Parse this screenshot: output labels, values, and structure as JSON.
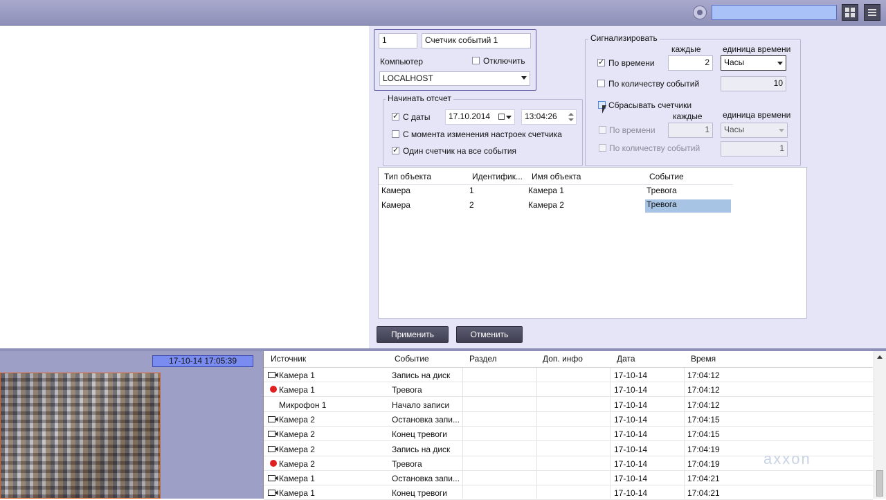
{
  "search": {
    "value": ""
  },
  "counter": {
    "id": "1",
    "name": "Счетчик событий 1",
    "computer_label": "Компьютер",
    "disable_label": "Отключить",
    "computer_value": "LOCALHOST"
  },
  "start": {
    "title": "Начинать отсчет",
    "from_date_label": "С даты",
    "date": "17.10.2014",
    "time": "13:04:26",
    "from_settings_label": "С момента изменения настроек счетчика",
    "one_counter_label": "Один счетчик на все события"
  },
  "signal": {
    "title": "Сигнализировать",
    "every_label": "каждые",
    "unit_label": "единица времени",
    "by_time_label": "По времени",
    "by_time_value": "2",
    "by_time_unit": "Часы",
    "by_count_label": "По количеству событий",
    "by_count_value": "10",
    "reset_label": "Сбрасывать счетчики",
    "reset_every_label": "каждые",
    "reset_unit_label": "единица времени",
    "reset_by_time_label": "По времени",
    "reset_by_time_value": "1",
    "reset_by_time_unit": "Часы",
    "reset_by_count_label": "По количеству событий",
    "reset_by_count_value": "1"
  },
  "objects": {
    "headers": [
      "Тип объекта",
      "Идентифик...",
      "Имя объекта",
      "Событие"
    ],
    "rows": [
      [
        "Камера",
        "1",
        "Камера 1",
        "Тревога"
      ],
      [
        "Камера",
        "2",
        "Камера 2",
        "Тревога"
      ]
    ]
  },
  "buttons": {
    "apply": "Применить",
    "cancel": "Отменить"
  },
  "camera": {
    "timestamp": "17-10-14   17:05:39"
  },
  "log": {
    "headers": [
      "Источник",
      "Событие",
      "Раздел",
      "Доп. инфо",
      "Дата",
      "Время"
    ],
    "rows": [
      {
        "icon": "camera",
        "source": "Камера 1",
        "event": "Запись на диск",
        "date": "17-10-14",
        "time": "17:04:12"
      },
      {
        "icon": "alarm",
        "source": "Камера 1",
        "event": "Тревога",
        "date": "17-10-14",
        "time": "17:04:12"
      },
      {
        "icon": "none",
        "source": "Микрофон 1",
        "event": "Начало записи",
        "date": "17-10-14",
        "time": "17:04:12"
      },
      {
        "icon": "camera",
        "source": "Камера 2",
        "event": "Остановка запи...",
        "date": "17-10-14",
        "time": "17:04:15"
      },
      {
        "icon": "camera",
        "source": "Камера 2",
        "event": "Конец тревоги",
        "date": "17-10-14",
        "time": "17:04:15"
      },
      {
        "icon": "camera",
        "source": "Камера 2",
        "event": "Запись на диск",
        "date": "17-10-14",
        "time": "17:04:19"
      },
      {
        "icon": "alarm",
        "source": "Камера 2",
        "event": "Тревога",
        "date": "17-10-14",
        "time": "17:04:19"
      },
      {
        "icon": "camera",
        "source": "Камера 1",
        "event": "Остановка запи...",
        "date": "17-10-14",
        "time": "17:04:21"
      },
      {
        "icon": "camera",
        "source": "Камера 1",
        "event": "Конец тревоги",
        "date": "17-10-14",
        "time": "17:04:21"
      }
    ]
  },
  "watermark": "axxon",
  "colors": {
    "panel": "#e5e5f7",
    "topbar": "#9c9dc4",
    "selection": "#a8c4e4",
    "alarm": "#e02020"
  }
}
